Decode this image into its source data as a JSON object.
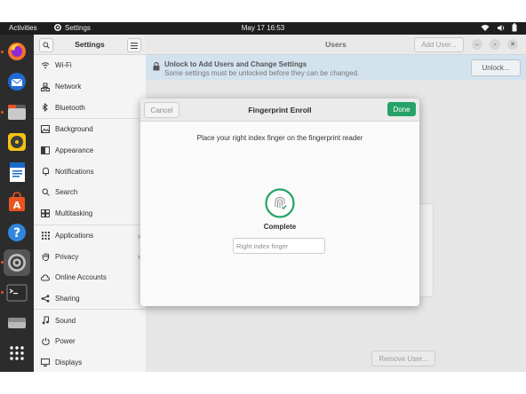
{
  "topbar": {
    "activities": "Activities",
    "app_name": "Settings",
    "clock": "May 17  16:53"
  },
  "dock": {
    "items": [
      "Firefox",
      "Thunderbird",
      "Files",
      "Rhythmbox",
      "LibreOffice Writer",
      "Ubuntu Software",
      "Help",
      "Settings",
      "Terminal",
      "Disks",
      "Show Applications"
    ]
  },
  "sidebar": {
    "title": "Settings",
    "items": [
      {
        "label": "Wi-Fi",
        "icon": "wifi-icon"
      },
      {
        "label": "Network",
        "icon": "network-icon"
      },
      {
        "label": "Bluetooth",
        "icon": "bluetooth-icon"
      },
      {
        "label": "Background",
        "icon": "background-icon"
      },
      {
        "label": "Appearance",
        "icon": "appearance-icon"
      },
      {
        "label": "Notifications",
        "icon": "bell-icon"
      },
      {
        "label": "Search",
        "icon": "search-icon"
      },
      {
        "label": "Multitasking",
        "icon": "multitasking-icon"
      },
      {
        "label": "Applications",
        "icon": "applications-icon"
      },
      {
        "label": "Privacy",
        "icon": "hand-icon"
      },
      {
        "label": "Online Accounts",
        "icon": "cloud-icon"
      },
      {
        "label": "Sharing",
        "icon": "share-icon"
      },
      {
        "label": "Sound",
        "icon": "music-note-icon"
      },
      {
        "label": "Power",
        "icon": "power-icon"
      },
      {
        "label": "Displays",
        "icon": "display-icon"
      }
    ]
  },
  "main": {
    "title": "Users",
    "add_user": "Add User...",
    "remove_user": "Remove User...",
    "infobar": {
      "title": "Unlock to Add Users and Change Settings",
      "subtitle": "Some settings must be unlocked before they can be changed.",
      "unlock_label": "Unlock..."
    }
  },
  "dialog": {
    "title": "Fingerprint Enroll",
    "cancel_label": "Cancel",
    "done_label": "Done",
    "instruction": "Place your right index finger on the fingerprint reader",
    "status": "Complete",
    "finger_placeholder": "Right index finger"
  },
  "colors": {
    "accent_green": "#26a269",
    "ubuntu_orange": "#e95420",
    "infobar_blue": "#d3e3ee"
  }
}
